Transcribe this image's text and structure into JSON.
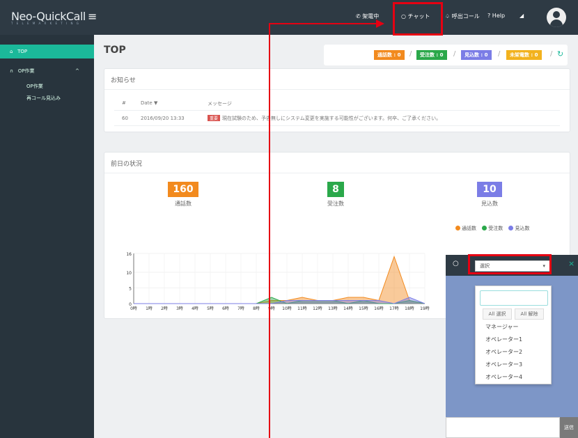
{
  "app": {
    "logo": "Neo-QuickCall",
    "logo_tagline": "T E L E M A R K E T I N G"
  },
  "topnav": {
    "items": [
      {
        "icon": "phone-icon",
        "label": "架電中"
      },
      {
        "icon": "chat-icon",
        "label": "チャット"
      },
      {
        "icon": "bell-icon",
        "label": "呼出コール"
      },
      {
        "icon": "help-icon",
        "label": "Help"
      }
    ]
  },
  "sidebar": {
    "items": [
      {
        "icon": "home-icon",
        "label": "TOP"
      },
      {
        "icon": "headset-icon",
        "label": "OP作業"
      }
    ],
    "subitems": [
      "OP作業",
      "再コール見込み"
    ]
  },
  "page": {
    "title": "TOP"
  },
  "counters": [
    {
      "label": "通話数 : 0",
      "color": "#f28a1e"
    },
    {
      "label": "受注数 : 0",
      "color": "#2aa84a"
    },
    {
      "label": "見込数 : 0",
      "color": "#7b7de6"
    },
    {
      "label": "未架電数 : 0",
      "color": "#f2b21e"
    }
  ],
  "notices": {
    "title": "お知らせ",
    "headers": [
      "#",
      "Date ▼",
      "メッセージ"
    ],
    "rows": [
      {
        "id": "60",
        "date": "2016/09/20 13:33",
        "badge": "重要",
        "message": "現在試験のため、予告無しにシステム変更を実施する可能性がございます。何卒、ご了承ください。"
      }
    ]
  },
  "yesterday": {
    "title": "前日の状況",
    "stats": [
      {
        "value": "160",
        "label": "通話数",
        "color": "#f28a1e"
      },
      {
        "value": "8",
        "label": "受注数",
        "color": "#2aa84a"
      },
      {
        "value": "10",
        "label": "見込数",
        "color": "#7b7de6"
      }
    ]
  },
  "chart_data": {
    "type": "area",
    "x": [
      "0時",
      "1時",
      "2時",
      "3時",
      "4時",
      "5時",
      "6時",
      "7時",
      "8時",
      "9時",
      "10時",
      "11時",
      "12時",
      "13時",
      "14時",
      "15時",
      "16時",
      "17時",
      "18時",
      "19時"
    ],
    "series": [
      {
        "name": "通話数",
        "color": "#f28a1e",
        "values": [
          0,
          0,
          0,
          0,
          0,
          0,
          0,
          0,
          0,
          1,
          1,
          2,
          1,
          1,
          2,
          2,
          1,
          15,
          1,
          0
        ]
      },
      {
        "name": "受注数",
        "color": "#2aa84a",
        "values": [
          0,
          0,
          0,
          0,
          0,
          0,
          0,
          0,
          0,
          2,
          0,
          1,
          1,
          1,
          0,
          1,
          0,
          0,
          1,
          0
        ]
      },
      {
        "name": "見込数",
        "color": "#7b7de6",
        "values": [
          0,
          0,
          0,
          0,
          0,
          0,
          0,
          0,
          0,
          0,
          1,
          1,
          1,
          1,
          1,
          1,
          1,
          0,
          2,
          0
        ]
      }
    ],
    "y_ticks": [
      "16",
      "10",
      "5",
      "0"
    ],
    "ylim": [
      0,
      16
    ],
    "legend_position": "top-right"
  },
  "chat": {
    "select_value": "選択",
    "select_all": "All 選択",
    "clear_all": "All 解除",
    "options": [
      "マネージャー",
      "オペレーター1",
      "オペレーター2",
      "オペレーター3",
      "オペレーター4"
    ],
    "send": "送信"
  }
}
